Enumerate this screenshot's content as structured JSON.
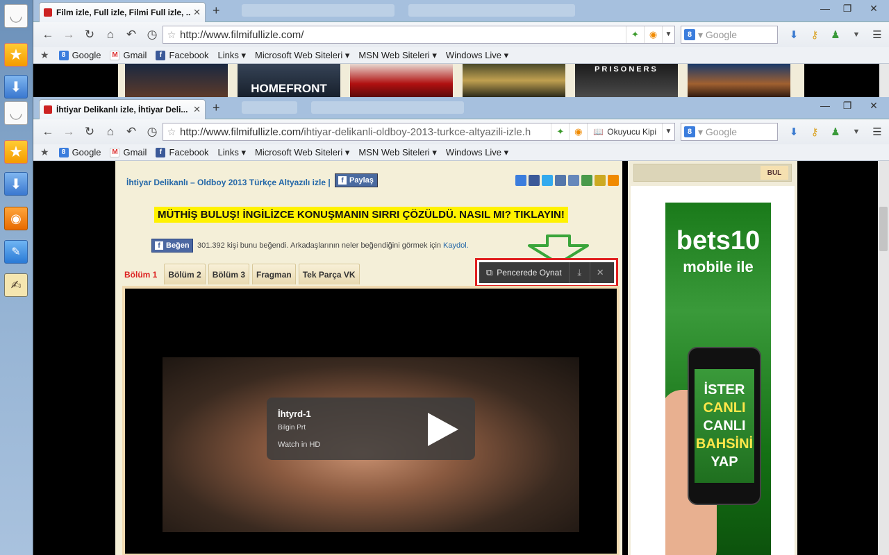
{
  "dock": {
    "items": [
      "smiley-icon",
      "star-icon",
      "download-icon",
      "smiley-icon",
      "star-icon",
      "download-icon",
      "rss-icon",
      "pin-icon",
      "notepad-icon"
    ]
  },
  "window1": {
    "tab_title": "Film izle, Full izle, Filmi Full izle, ...",
    "url_host": "http://www.filmifullizle.com/",
    "url_path": "",
    "search_placeholder": "Google",
    "posters": [
      "",
      "HOMEFRONT",
      "",
      "",
      "PRISONERS",
      ""
    ]
  },
  "window2": {
    "tab_title": "İhtiyar Delikanlı izle, İhtiyar Deli...",
    "url_host": "http://www.filmifullizle.com/",
    "url_path": "ihtiyar-delikanli-oldboy-2013-turkce-altyazili-izle.h",
    "reader_label": "Okuyucu Kipi",
    "search_placeholder": "Google"
  },
  "bookmarks": [
    "Google",
    "Gmail",
    "Facebook",
    "Links ▾",
    "Microsoft Web Siteleri ▾",
    "MSN Web Siteleri ▾",
    "Windows Live ▾"
  ],
  "page": {
    "headline": "İhtiyar Delikanlı – Oldboy 2013 Türkçe Altyazılı izle  |",
    "share_label": "Paylaş",
    "promo": "MÜTHİŞ BULUŞ! İNGİLİZCE KONUŞMANIN SIRRI ÇÖZÜLDÜ. NASIL MI? TIKLAYIN!",
    "like_label": "Beğen",
    "like_text": "301.392 kişi bunu beğendi. Arkadaşlarının neler beğendiğini görmek için",
    "like_link": "Kaydol.",
    "tabs": [
      "Bölüm 1",
      "Bölüm 2",
      "Bölüm 3",
      "Fragman",
      "Tek Parça VK"
    ],
    "popup_label": "Pencerede Oynat",
    "video": {
      "title": "İhtyrd-1",
      "author": "Bilgin Prt",
      "hd_label": "Watch in HD"
    }
  },
  "sidebar": {
    "search_button": "BUL",
    "ad_brand": "bets10",
    "ad_sub": "mobile ile",
    "ad_lines": [
      "İSTER",
      "CANLI",
      "CANLI",
      "BAHSİNİ",
      "YAP"
    ]
  },
  "colors": {
    "promo_bg": "#fff200",
    "popup_border": "#e02020",
    "arrow": "#3aa53a",
    "link": "#2367a8"
  }
}
